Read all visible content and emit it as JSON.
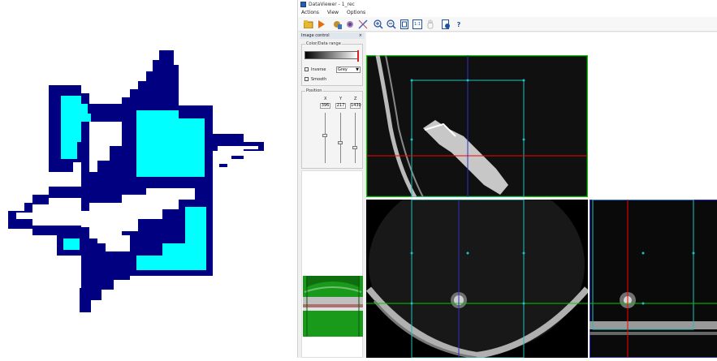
{
  "window": {
    "title": "DataViewer - 1_rec"
  },
  "menu": {
    "items": [
      "Actions",
      "View",
      "Options"
    ]
  },
  "toolbar": {
    "buttons": [
      "open-folder-icon",
      "play-icon",
      "dataset-settings-icon",
      "3d-settings-icon",
      "axes-icon",
      "zoom-in-icon",
      "zoom-out-icon",
      "fit-view-icon",
      "actual-size-icon",
      "hand-pan-icon",
      "info-icon",
      "help-icon"
    ],
    "actual_size_label": "1:1",
    "help_label": "?"
  },
  "panel": {
    "title": "Image control",
    "close_label": "×",
    "color_group_title": "Color/Data range",
    "inverse_label": "Inverse",
    "palette_value": "Grey",
    "smooth_label": "Smooth",
    "position_group_title": "Position",
    "axes": [
      {
        "label": "X",
        "value": "396"
      },
      {
        "label": "Y",
        "value": "217"
      },
      {
        "label": "Z",
        "value": "1430"
      }
    ],
    "slider_levels": [
      0.45,
      0.6,
      0.7
    ]
  },
  "colors": {
    "logo_dark": "#000080",
    "logo_cyan": "#00ffff",
    "crosshair_red": "#ff0000",
    "crosshair_blue": "#3030c0",
    "roi_cyan": "#20c0c0",
    "view_border_green": "#00cc00",
    "preview_green": "#1a9a1a"
  }
}
